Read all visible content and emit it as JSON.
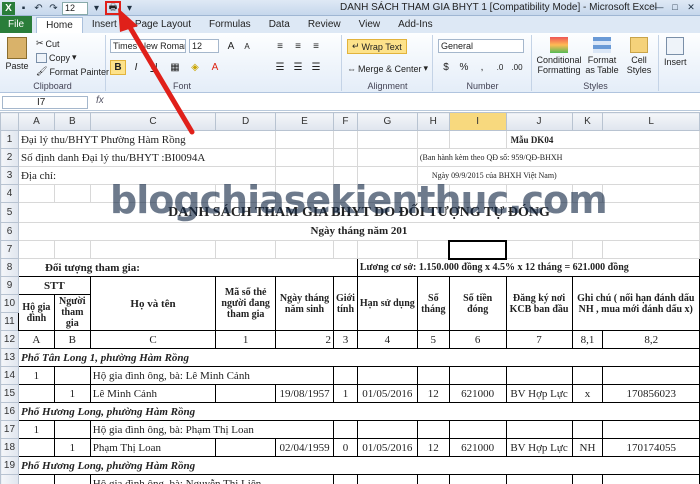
{
  "window": {
    "title": "DANH SÁCH THAM GIA BHYT 1  [Compatibility Mode]  -  Microsoft Excel",
    "font_size_qat": "12"
  },
  "tabs": [
    "File",
    "Home",
    "Insert",
    "Page Layout",
    "Formulas",
    "Data",
    "Review",
    "View",
    "Add-Ins"
  ],
  "ribbon": {
    "paste": "Paste",
    "cut": "Cut",
    "copy": "Copy",
    "format_painter": "Format Painter",
    "clipboard": "Clipboard",
    "font_name": "Times New Roman",
    "font_size": "12",
    "bold": "B",
    "italic": "I",
    "underline": "U",
    "font": "Font",
    "wrap_text": "Wrap Text",
    "merge_center": "Merge & Center",
    "alignment": "Alignment",
    "number_format": "General",
    "number": "Number",
    "conditional_formatting": "Conditional Formatting",
    "format_as_table": "Format as Table",
    "cell_styles": "Cell Styles",
    "styles": "Styles",
    "insert": "Insert"
  },
  "formula": {
    "name_box": "I7",
    "fx": "fx"
  },
  "columns": [
    "A",
    "B",
    "C",
    "D",
    "E",
    "F",
    "G",
    "H",
    "I",
    "J",
    "K",
    "L"
  ],
  "rows": [
    "1",
    "2",
    "3",
    "4",
    "5",
    "6",
    "7",
    "8",
    "9",
    "10",
    "11",
    "12",
    "13",
    "14",
    "15",
    "16",
    "17",
    "18",
    "19"
  ],
  "cells": {
    "r1a": "Đại lý thu/BHYT Phường Hàm Rồng",
    "r1k": "Mẫu DK04",
    "r2a": "Số định danh Đại lý thu/BHYT :BI0094A",
    "r2i": "(Ban hành kèm theo QĐ số: 959/QĐ-BHXH",
    "r3a": "Địa chỉ:",
    "r3i": "Ngày 09/9/2015 của BHXH Việt Nam)",
    "r5": "DANH SÁCH THAM GIA BHYT DO ĐỐI TƯỢNG TỰ ĐÓNG",
    "r6": "Ngày      tháng      năm 201",
    "r8a": "Đối tượng tham gia:",
    "r8g": "Lương cơ sở: 1.150.000 đồng x 4.5% x 12 tháng = 621.000 đồng",
    "h_stt": "STT",
    "h_hgd": "Hộ gia đình",
    "h_ntg": "Người tham gia",
    "h_hoten": "Họ và tên",
    "h_maso": "Mã số thẻ người đang tham gia",
    "h_ngaysinh": "Ngày tháng năm sinh",
    "h_gioi": "Giới tính",
    "h_han": "Hạn sử dụng",
    "h_sothang": "Số tháng",
    "h_sotien": "Số tiền đóng",
    "h_dangky": "Đăng ký nơi KCB ban đầu",
    "h_ghichu": "Ghi chú ( nối hạn đánh dấu NH , mua mới đánh dấu x)",
    "r12": [
      "A",
      "B",
      "C",
      "1",
      "2",
      "3",
      "4",
      "5",
      "6",
      "7",
      "8,1",
      "8,2"
    ],
    "r13": "Phố Tân Long 1, phường Hàm Rồng",
    "r14a": "1",
    "r14c": "Hộ gia đình ông, bà: Lê Minh Cảnh",
    "r15": [
      "",
      "1",
      "Lê Minh Cảnh",
      "",
      "19/08/1957",
      "1",
      "01/05/2016",
      "12",
      "621000",
      "BV Hợp Lực",
      "x",
      "170856023"
    ],
    "r16": "Phố Hương Long, phường Hàm Rồng",
    "r17a": "1",
    "r17c": "Hộ gia đình ông, bà: Phạm Thị Loan",
    "r18": [
      "",
      "1",
      "Phạm Thị Loan",
      "",
      "02/04/1959",
      "0",
      "01/05/2016",
      "12",
      "621000",
      "BV Hợp Lực",
      "NH",
      "170174055"
    ],
    "r19": "Phố Hương Long, phường Hàm Rồng",
    "r20c": "Hộ gia đình ông, bà: Nguyễn Thị Liên"
  },
  "watermark": "blogchiasekienthuc.com"
}
